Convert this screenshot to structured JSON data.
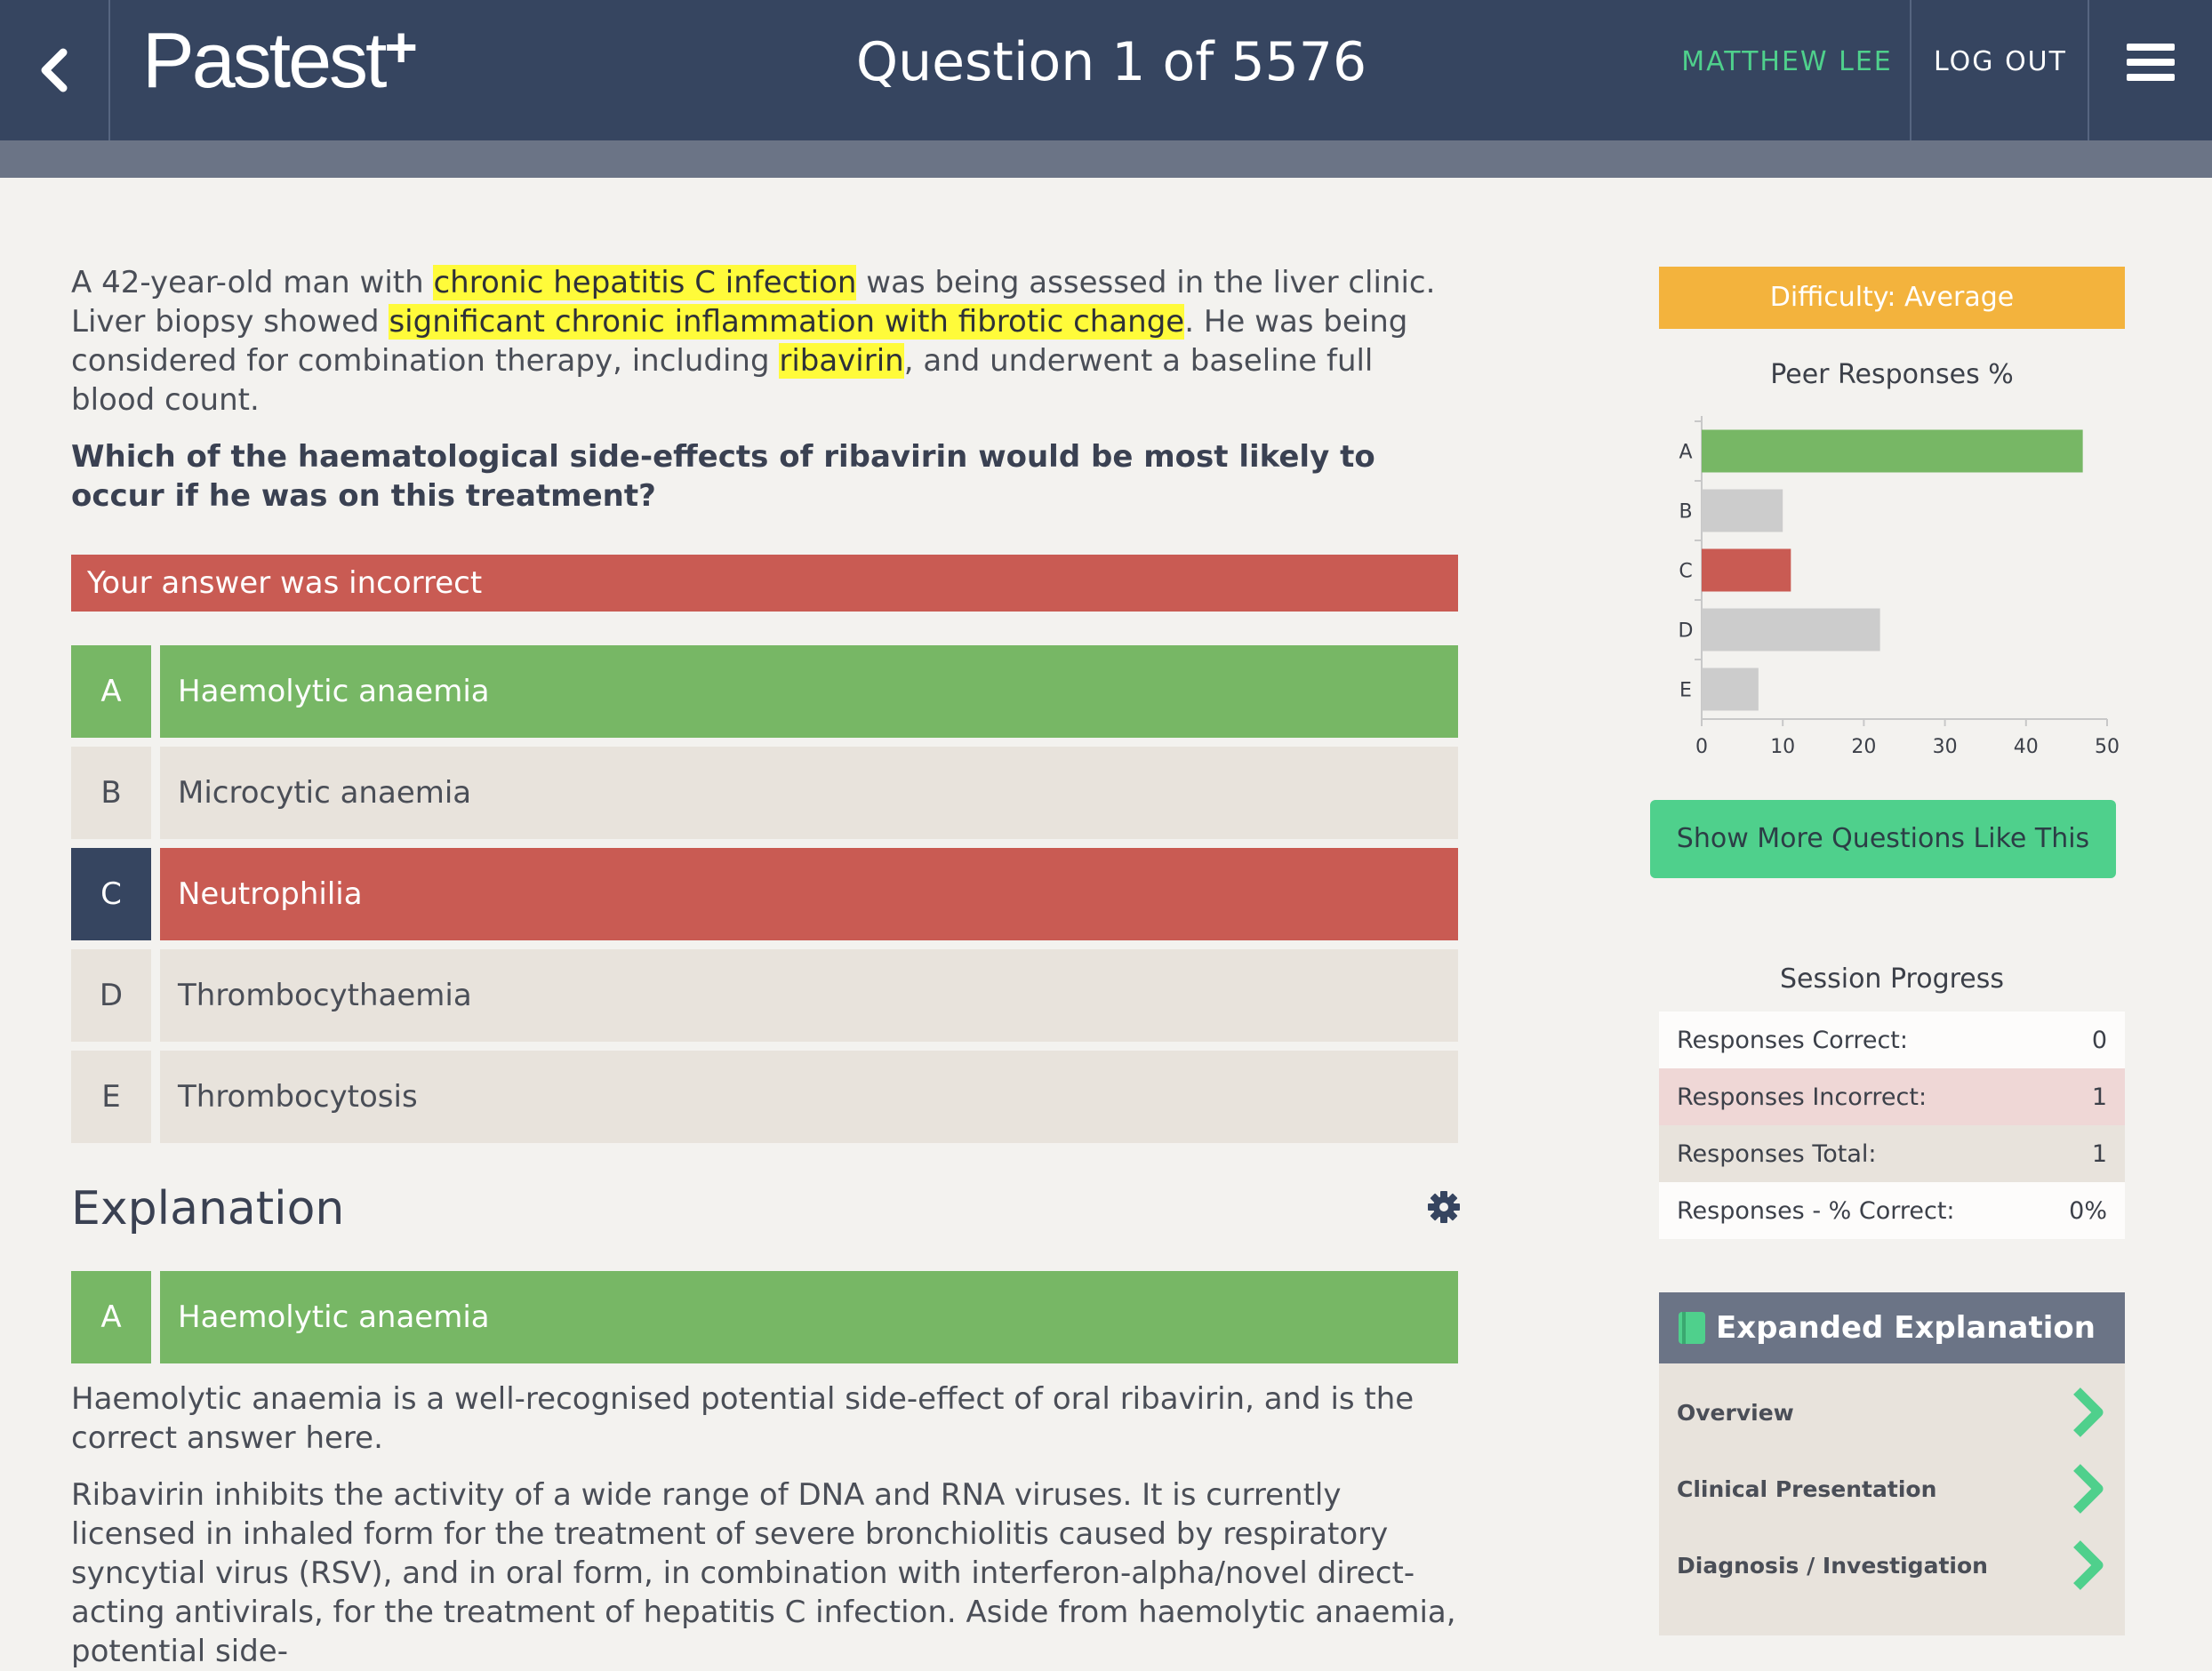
{
  "header": {
    "logo_text": "Pastest",
    "logo_plus": "+",
    "question_title": "Question 1 of 5576",
    "user_name": "MATTHEW LEE",
    "logout_label": "LOG OUT"
  },
  "question": {
    "stem_parts": [
      {
        "text": "A 42-year-old man with ",
        "hl": false
      },
      {
        "text": "chronic hepatitis C infection",
        "hl": true
      },
      {
        "text": " was being assessed in the liver clinic. Liver biopsy showed ",
        "hl": false
      },
      {
        "text": "significant chronic inflammation with fibrotic change",
        "hl": true
      },
      {
        "text": ". He was being considered for combination therapy, including ",
        "hl": false
      },
      {
        "text": "ribavirin",
        "hl": true
      },
      {
        "text": ", and underwent a baseline full blood count.",
        "hl": false
      }
    ],
    "prompt": "Which of the haematological side-effects of ribavirin would be most likely to occur if he was on this treatment?",
    "result": "Your answer was incorrect"
  },
  "options": [
    {
      "letter": "A",
      "text": "Haemolytic anaemia",
      "state": "correct"
    },
    {
      "letter": "B",
      "text": "Microcytic anaemia",
      "state": "neutral"
    },
    {
      "letter": "C",
      "text": "Neutrophilia",
      "state": "wrong"
    },
    {
      "letter": "D",
      "text": "Thrombocythaemia",
      "state": "neutral"
    },
    {
      "letter": "E",
      "text": "Thrombocytosis",
      "state": "neutral"
    }
  ],
  "explanation": {
    "heading": "Explanation",
    "answer_letter": "A",
    "answer_text": "Haemolytic anaemia",
    "para1": "Haemolytic anaemia is a well-recognised potential side-effect of oral ribavirin, and is the correct answer here.",
    "para2": "Ribavirin inhibits the activity of a wide range of DNA and RNA viruses. It is currently licensed in inhaled form for the treatment of severe bronchiolitis caused by respiratory syncytial virus (RSV), and in oral form, in combination with interferon-alpha/novel direct-acting antivirals, for the treatment of hepatitis C infection. Aside from haemolytic anaemia, potential side-"
  },
  "sidebar": {
    "difficulty": "Difficulty: Average",
    "peer_title": "Peer Responses %",
    "more_button": "Show More Questions Like This",
    "session_title": "Session Progress",
    "session_rows": [
      {
        "label": "Responses Correct:",
        "value": "0"
      },
      {
        "label": "Responses Incorrect:",
        "value": "1"
      },
      {
        "label": "Responses Total:",
        "value": "1"
      },
      {
        "label": "Responses - % Correct:",
        "value": "0%"
      }
    ],
    "expanded_title": "Expanded Explanation",
    "expanded_items": [
      "Overview",
      "Clinical Presentation",
      "Diagnosis / Investigation"
    ]
  },
  "colors": {
    "correct": "#77b765",
    "wrong": "#c95b53",
    "neutral_bar": "#cccccc",
    "accent_green": "#4fd08c",
    "difficulty": "#f3b33d",
    "nav": "#364560"
  },
  "chart_data": {
    "type": "bar",
    "orientation": "horizontal",
    "title": "Peer Responses %",
    "categories": [
      "A",
      "B",
      "C",
      "D",
      "E"
    ],
    "values": [
      47,
      10,
      11,
      22,
      7
    ],
    "bar_colors": [
      "#77b765",
      "#cccccc",
      "#c95b53",
      "#cccccc",
      "#cccccc"
    ],
    "xlim": [
      0,
      50
    ],
    "xticks": [
      0,
      10,
      20,
      30,
      40,
      50
    ],
    "grid": false
  }
}
